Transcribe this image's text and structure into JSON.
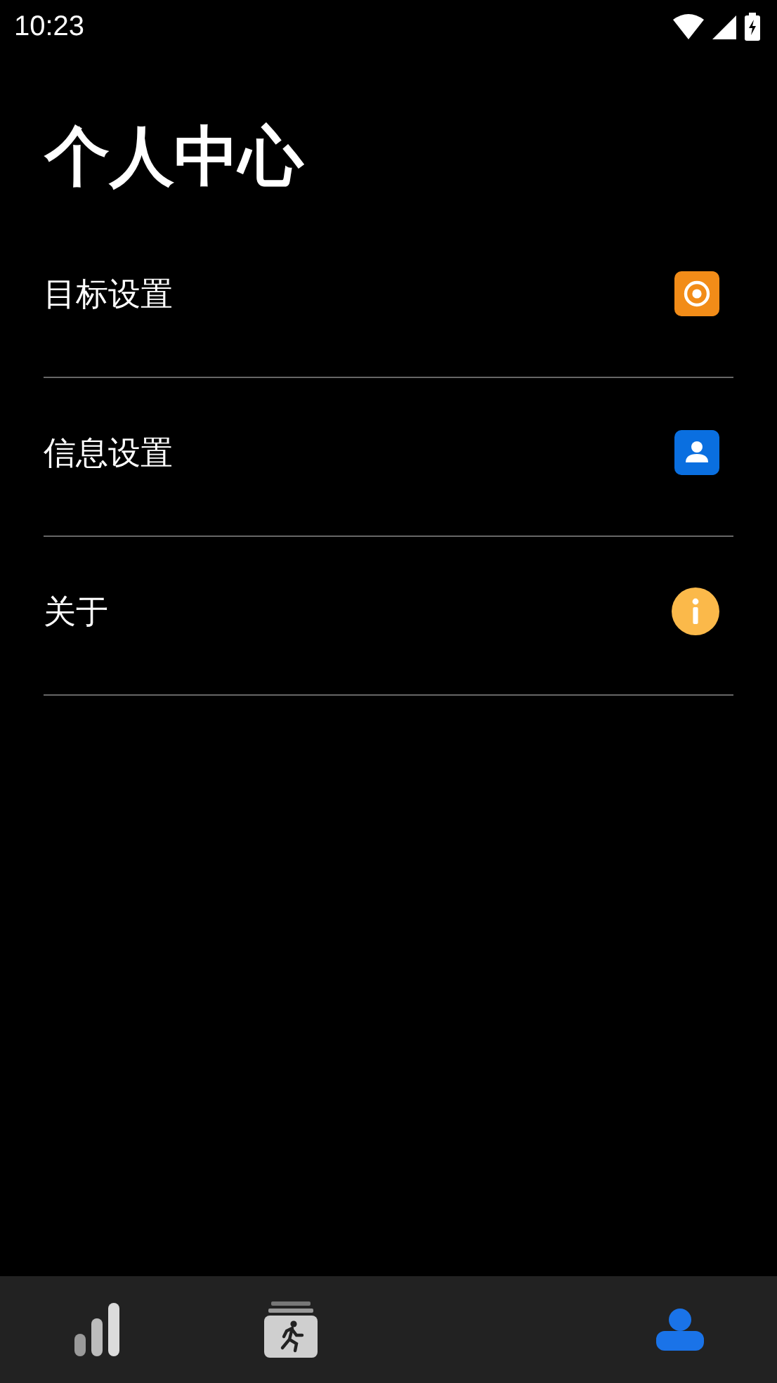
{
  "status_bar": {
    "time": "10:23"
  },
  "title": "个人中心",
  "menu": [
    {
      "label": "目标设置",
      "kind": "target"
    },
    {
      "label": "信息设置",
      "kind": "person"
    },
    {
      "label": "关于",
      "kind": "info"
    }
  ],
  "bottom_nav": [
    {
      "kind": "chart",
      "selected": false
    },
    {
      "kind": "run",
      "selected": false
    },
    {
      "kind": "profile",
      "selected": true
    }
  ]
}
